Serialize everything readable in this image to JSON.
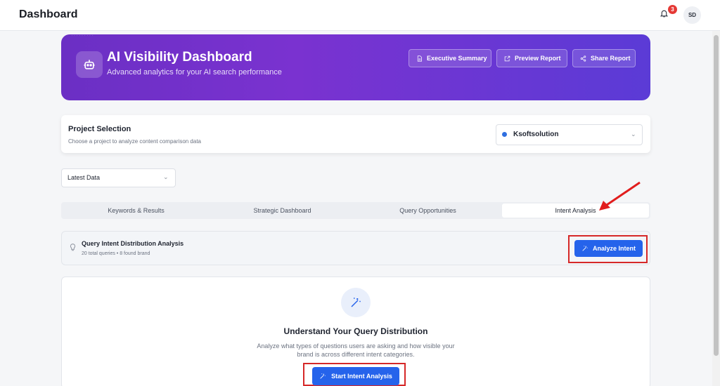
{
  "topbar": {
    "title": "Dashboard",
    "notifications_count": "3",
    "avatar_initials": "SD"
  },
  "hero": {
    "title": "AI Visibility Dashboard",
    "subtitle": "Advanced analytics for your AI search performance",
    "buttons": [
      {
        "label": "Executive Summary",
        "icon": "document-icon"
      },
      {
        "label": "Preview Report",
        "icon": "external-link-icon"
      },
      {
        "label": "Share Report",
        "icon": "share-icon"
      }
    ]
  },
  "project": {
    "title": "Project Selection",
    "description": "Choose a project to analyze content comparison data",
    "selected": "Ksoftsolution"
  },
  "data_filter": {
    "selected": "Latest Data"
  },
  "tabs": [
    {
      "label": "Keywords & Results",
      "active": false
    },
    {
      "label": "Strategic Dashboard",
      "active": false
    },
    {
      "label": "Query Opportunities",
      "active": false
    },
    {
      "label": "Intent Analysis",
      "active": true
    }
  ],
  "intent_header": {
    "title": "Query Intent Distribution Analysis",
    "subtitle": "20 total queries • 8 found brand",
    "button_label": "Analyze Intent"
  },
  "empty_state": {
    "title": "Understand Your Query Distribution",
    "description": "Analyze what types of questions users are asking and how visible your brand is across different intent categories.",
    "button_label": "Start Intent Analysis"
  },
  "colors": {
    "accent": "#2563eb",
    "hero_start": "#6b2fc4",
    "hero_end": "#5b3bd6",
    "annotation": "#d62828"
  }
}
